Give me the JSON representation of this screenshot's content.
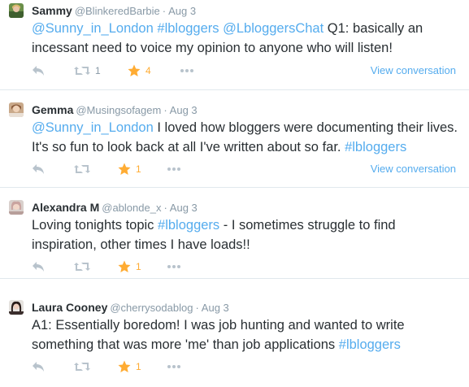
{
  "tweets": [
    {
      "fullname": "Sammy",
      "username": "@BlinkeredBarbie",
      "separator": "·",
      "time": "Aug 3",
      "text_parts": [
        {
          "text": "@Sunny_in_London",
          "link": true
        },
        {
          "text": " ",
          "link": false
        },
        {
          "text": "#lbloggers",
          "link": true
        },
        {
          "text": " ",
          "link": false
        },
        {
          "text": "@LbloggersChat",
          "link": true
        },
        {
          "text": " Q1: basically an incessant need to voice my opinion to anyone who will listen!",
          "link": false
        }
      ],
      "retweets": "1",
      "favorites": "4",
      "view_conversation": "View conversation"
    },
    {
      "fullname": "Gemma",
      "username": "@Musingsofagem",
      "separator": "·",
      "time": "Aug 3",
      "text_parts": [
        {
          "text": "@Sunny_in_London",
          "link": true
        },
        {
          "text": " I loved how bloggers were documenting their lives.  It's so fun to look back at all I've written about so far. ",
          "link": false
        },
        {
          "text": "#lbloggers",
          "link": true
        }
      ],
      "retweets": "",
      "favorites": "1",
      "view_conversation": "View conversation"
    },
    {
      "fullname": "Alexandra M",
      "username": "@ablonde_x",
      "separator": "·",
      "time": "Aug 3",
      "text_parts": [
        {
          "text": "Loving tonights topic ",
          "link": false
        },
        {
          "text": "#lbloggers",
          "link": true
        },
        {
          "text": " - I sometimes struggle to find inspiration, other times I have loads!!",
          "link": false
        }
      ],
      "retweets": "",
      "favorites": "1",
      "view_conversation": ""
    },
    {
      "fullname": "Laura Cooney",
      "username": "@cherrysodablog",
      "separator": "·",
      "time": "Aug 3",
      "text_parts": [
        {
          "text": "A1: Essentially boredom! I was job hunting and wanted to write something that was more 'me' than job applications ",
          "link": false
        },
        {
          "text": "#lbloggers",
          "link": true
        }
      ],
      "retweets": "",
      "favorites": "1",
      "view_conversation": ""
    }
  ],
  "icons": {
    "reply": "reply-icon",
    "retweet": "retweet-icon",
    "favorite": "star-icon",
    "more": "more-icon"
  },
  "colors": {
    "link": "#55acee",
    "muted": "#8899a6",
    "favorite": "#ffac33",
    "text": "#292f33"
  }
}
